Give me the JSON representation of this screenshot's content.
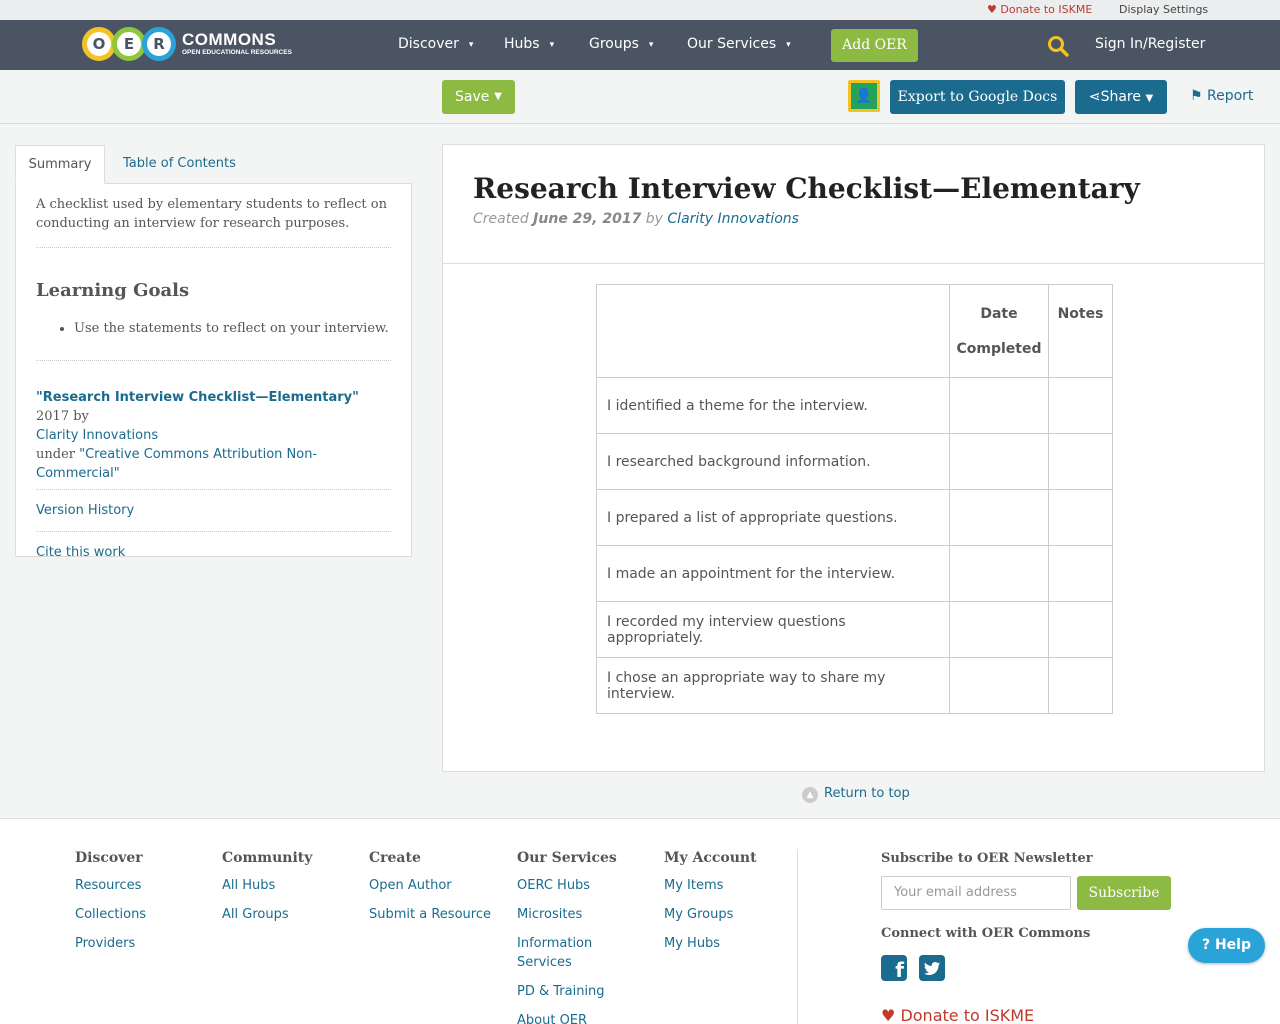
{
  "utility_bar": {
    "donate_label": "Donate to ISKME",
    "display_settings_label": "Display Settings"
  },
  "nav": {
    "logo_letters": [
      "O",
      "E",
      "R"
    ],
    "logo_title": "COMMONS",
    "logo_subtitle": "OPEN EDUCATIONAL RESOURCES",
    "items": [
      {
        "label": "Discover"
      },
      {
        "label": "Hubs"
      },
      {
        "label": "Groups"
      },
      {
        "label": "Our Services"
      }
    ],
    "add_oer_label": "Add OER",
    "signin_label": "Sign In/Register"
  },
  "toolbar": {
    "save_label": "Save",
    "export_label": "Export to Google Docs",
    "share_label": "Share",
    "report_label": "Report"
  },
  "sidebar": {
    "tabs": [
      {
        "label": "Summary",
        "active": true
      },
      {
        "label": "Table of Contents",
        "active": false
      }
    ],
    "summary_text": "A checklist used by elementary students to reflect on conducting an interview for research purposes.",
    "learning_goals_title": "Learning Goals",
    "learning_goals": [
      "Use the statements to reflect on your interview."
    ],
    "attribution": {
      "title_link": "\"Research Interview Checklist—Elementary\"",
      "year_by": " 2017 by",
      "author_link": "Clarity Innovations",
      "under_text": "under ",
      "license_link": "\"Creative Commons Attribution Non-Commercial\""
    },
    "version_history_label": "Version History",
    "cite_label": "Cite this work"
  },
  "resource": {
    "title": "Research Interview Checklist—Elementary",
    "created_label": "Created",
    "date": "June 29, 2017",
    "by_label": "by",
    "author": "Clarity Innovations"
  },
  "checklist_table": {
    "headers": [
      "",
      "Date Completed",
      "Notes"
    ],
    "header_date_line1": "Date",
    "header_date_line2": "Completed",
    "rows": [
      "I identified a theme for the interview.",
      "I researched background information.",
      "I prepared a list of appropriate questions.",
      "I made an appointment for the interview.",
      "I recorded my interview questions appropriately.",
      "I chose an appropriate way to share my interview."
    ]
  },
  "return_to_top_label": "Return to top",
  "footer": {
    "columns": [
      {
        "title": "Discover",
        "links": [
          "Resources",
          "Collections",
          "Providers"
        ]
      },
      {
        "title": "Community",
        "links": [
          "All Hubs",
          "All Groups"
        ]
      },
      {
        "title": "Create",
        "links": [
          "Open Author",
          "Submit a Resource"
        ]
      },
      {
        "title": "Our Services",
        "links": [
          "OERC Hubs",
          "Microsites",
          "Information Services",
          "PD & Training",
          "About OER"
        ]
      },
      {
        "title": "My Account",
        "links": [
          "My Items",
          "My Groups",
          "My Hubs"
        ]
      }
    ],
    "newsletter_title": "Subscribe to OER Newsletter",
    "email_placeholder": "Your email address",
    "subscribe_label": "Subscribe",
    "connect_title": "Connect with OER Commons",
    "donate_label": "Donate to ISKME"
  },
  "help_label": "Help",
  "colors": {
    "nav_bg": "#4a5462",
    "accent_green": "#8dba43",
    "accent_blue": "#1b6b8f",
    "donate_red": "#c0392b"
  },
  "icons": [
    "heart-icon",
    "search-icon",
    "chevron-down-icon",
    "google-classroom-icon",
    "share-icon",
    "flag-icon",
    "arrow-up-icon",
    "facebook-icon",
    "twitter-icon",
    "help-icon"
  ]
}
